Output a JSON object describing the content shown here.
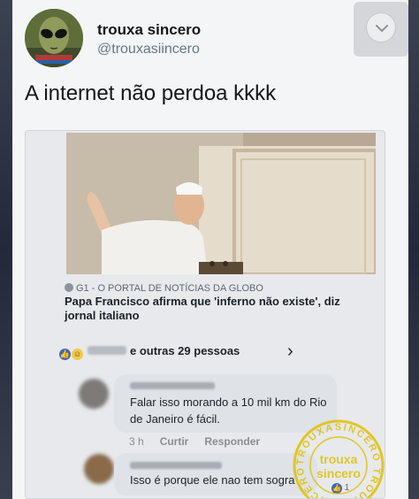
{
  "tweet": {
    "display_name": "trouxa sincero",
    "handle": "@trouxasiincero",
    "text": "A internet não perdoa kkkk",
    "menu_icon": "chevron-down-icon"
  },
  "article": {
    "source": "G1 - O PORTAL DE NOTÍCIAS DA GLOBO",
    "title": "Papa Francisco afirma que 'inferno não existe', diz jornal italiano"
  },
  "reactions": {
    "summary": "e outras 29 pessoas",
    "icons": [
      "like-icon",
      "haha-icon"
    ]
  },
  "comments": [
    {
      "text": "Falar isso morando a 10 mil km do Rio de Janeiro é fácil.",
      "time": "3 h",
      "like_label": "Curtir",
      "reply_label": "Responder"
    },
    {
      "text": "Isso é porque ele nao tem sogra",
      "likes": "1"
    }
  ],
  "watermark": {
    "line1": "trouxa",
    "line2": "sincero",
    "ring": "TROUXASINCERO"
  },
  "colors": {
    "facebook_blue": "#4267b2",
    "watermark_gold": "#e0c000"
  }
}
